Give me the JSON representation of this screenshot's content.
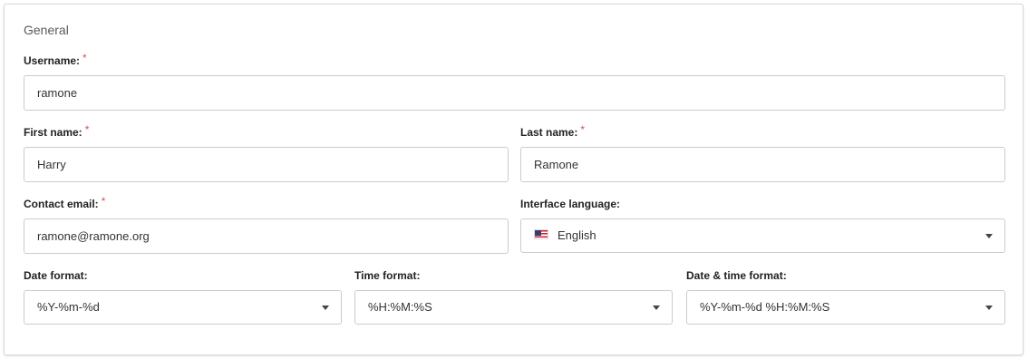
{
  "section": {
    "title": "General"
  },
  "required_mark": "*",
  "fields": {
    "username": {
      "label": "Username:",
      "value": "ramone"
    },
    "first_name": {
      "label": "First name:",
      "value": "Harry"
    },
    "last_name": {
      "label": "Last name:",
      "value": "Ramone"
    },
    "contact_email": {
      "label": "Contact email:",
      "value": "ramone@ramone.org"
    },
    "interface_language": {
      "label": "Interface language:",
      "value": "English",
      "icon": "us-flag-icon"
    },
    "date_format": {
      "label": "Date format:",
      "value": "%Y-%m-%d"
    },
    "time_format": {
      "label": "Time format:",
      "value": "%H:%M:%S"
    },
    "datetime_format": {
      "label": "Date & time format:",
      "value": "%Y-%m-%d %H:%M:%S"
    }
  },
  "colors": {
    "required": "#d9534f",
    "border": "#cccccc"
  }
}
